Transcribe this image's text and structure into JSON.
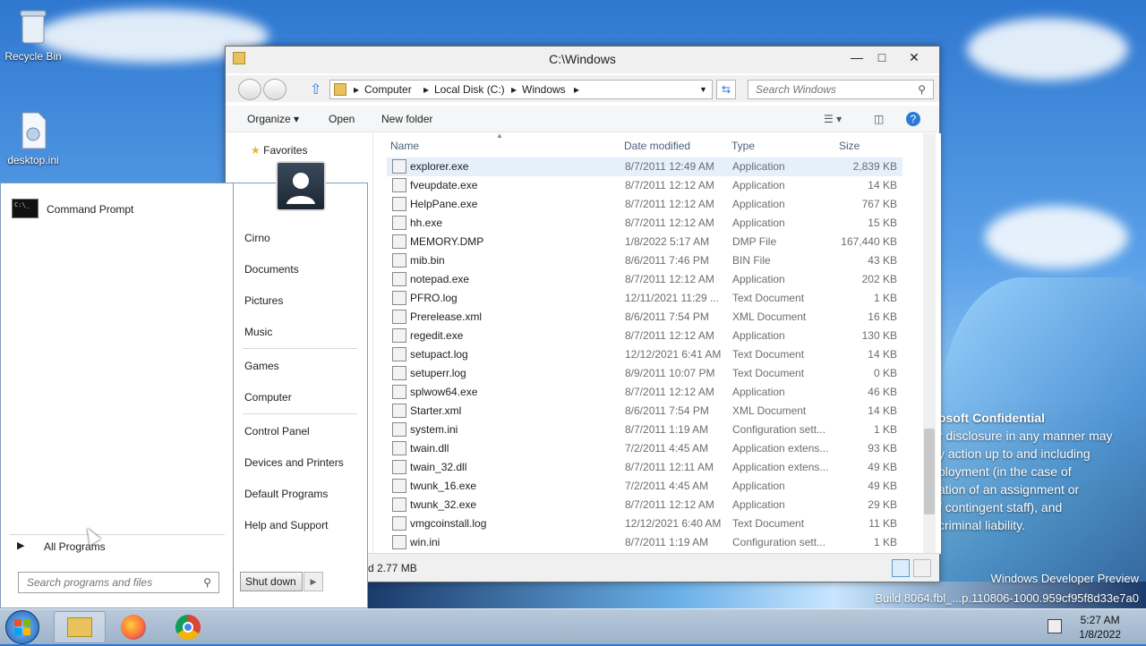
{
  "desktop": {
    "icons": [
      {
        "label": "Recycle Bin",
        "icon": "recycle-bin-icon"
      },
      {
        "label": "desktop.ini",
        "icon": "ini-file-icon"
      }
    ],
    "watermark": {
      "line1": "osoft Confidential",
      "line2": "r disclosure in any manner may",
      "line3": "y action up to and including",
      "line4": "ployment (in the case of",
      "line5": "ation of an assignment or",
      "line6": "f contingent staff), and",
      "line7": "criminal liability.",
      "build1": "Windows Developer Preview",
      "build2": "Build 8064.fbl_...p.110806-1000.959cf95f8d33e7a0"
    }
  },
  "explorer": {
    "title": "C:\\Windows",
    "breadcrumb": [
      "Computer",
      "Local Disk (C:)",
      "Windows"
    ],
    "search_placeholder": "Search Windows",
    "commands": {
      "organize": "Organize",
      "open": "Open",
      "new_folder": "New folder"
    },
    "nav": {
      "favorites": "Favorites"
    },
    "columns": {
      "name": "Name",
      "date": "Date modified",
      "type": "Type",
      "size": "Size"
    },
    "files": [
      {
        "name": "explorer.exe",
        "date": "8/7/2011 12:49 AM",
        "type": "Application",
        "size": "2,839 KB"
      },
      {
        "name": "fveupdate.exe",
        "date": "8/7/2011 12:12 AM",
        "type": "Application",
        "size": "14 KB"
      },
      {
        "name": "HelpPane.exe",
        "date": "8/7/2011 12:12 AM",
        "type": "Application",
        "size": "767 KB"
      },
      {
        "name": "hh.exe",
        "date": "8/7/2011 12:12 AM",
        "type": "Application",
        "size": "15 KB"
      },
      {
        "name": "MEMORY.DMP",
        "date": "1/8/2022 5:17 AM",
        "type": "DMP File",
        "size": "167,440 KB"
      },
      {
        "name": "mib.bin",
        "date": "8/6/2011 7:46 PM",
        "type": "BIN File",
        "size": "43 KB"
      },
      {
        "name": "notepad.exe",
        "date": "8/7/2011 12:12 AM",
        "type": "Application",
        "size": "202 KB"
      },
      {
        "name": "PFRO.log",
        "date": "12/11/2021 11:29 ...",
        "type": "Text Document",
        "size": "1 KB"
      },
      {
        "name": "Prerelease.xml",
        "date": "8/6/2011 7:54 PM",
        "type": "XML Document",
        "size": "16 KB"
      },
      {
        "name": "regedit.exe",
        "date": "8/7/2011 12:12 AM",
        "type": "Application",
        "size": "130 KB"
      },
      {
        "name": "setupact.log",
        "date": "12/12/2021 6:41 AM",
        "type": "Text Document",
        "size": "14 KB"
      },
      {
        "name": "setuperr.log",
        "date": "8/9/2011 10:07 PM",
        "type": "Text Document",
        "size": "0 KB"
      },
      {
        "name": "splwow64.exe",
        "date": "8/7/2011 12:12 AM",
        "type": "Application",
        "size": "46 KB"
      },
      {
        "name": "Starter.xml",
        "date": "8/6/2011 7:54 PM",
        "type": "XML Document",
        "size": "14 KB"
      },
      {
        "name": "system.ini",
        "date": "8/7/2011 1:19 AM",
        "type": "Configuration sett...",
        "size": "1 KB"
      },
      {
        "name": "twain.dll",
        "date": "7/2/2011 4:45 AM",
        "type": "Application extens...",
        "size": "93 KB"
      },
      {
        "name": "twain_32.dll",
        "date": "8/7/2011 12:11 AM",
        "type": "Application extens...",
        "size": "49 KB"
      },
      {
        "name": "twunk_16.exe",
        "date": "7/2/2011 4:45 AM",
        "type": "Application",
        "size": "49 KB"
      },
      {
        "name": "twunk_32.exe",
        "date": "8/7/2011 12:12 AM",
        "type": "Application",
        "size": "29 KB"
      },
      {
        "name": "vmgcoinstall.log",
        "date": "12/12/2021 6:40 AM",
        "type": "Text Document",
        "size": "11 KB"
      },
      {
        "name": "win.ini",
        "date": "8/7/2011 1:19 AM",
        "type": "Configuration sett...",
        "size": "1 KB"
      }
    ],
    "status": "d 2.77 MB"
  },
  "startmenu": {
    "pinned": [
      {
        "label": "Command Prompt",
        "icon": "command-prompt-icon"
      }
    ],
    "all_programs": "All Programs",
    "search_placeholder": "Search programs and files",
    "right": {
      "user": "Cirno",
      "documents": "Documents",
      "pictures": "Pictures",
      "music": "Music",
      "games": "Games",
      "computer": "Computer",
      "control_panel": "Control Panel",
      "devices": "Devices and Printers",
      "default_programs": "Default Programs",
      "help": "Help and Support"
    },
    "shutdown": "Shut down"
  },
  "taskbar": {
    "apps": [
      {
        "icon": "file-explorer-icon"
      },
      {
        "icon": "firefox-icon"
      },
      {
        "icon": "chrome-icon"
      }
    ],
    "time": "5:27 AM",
    "date": "1/8/2022"
  }
}
